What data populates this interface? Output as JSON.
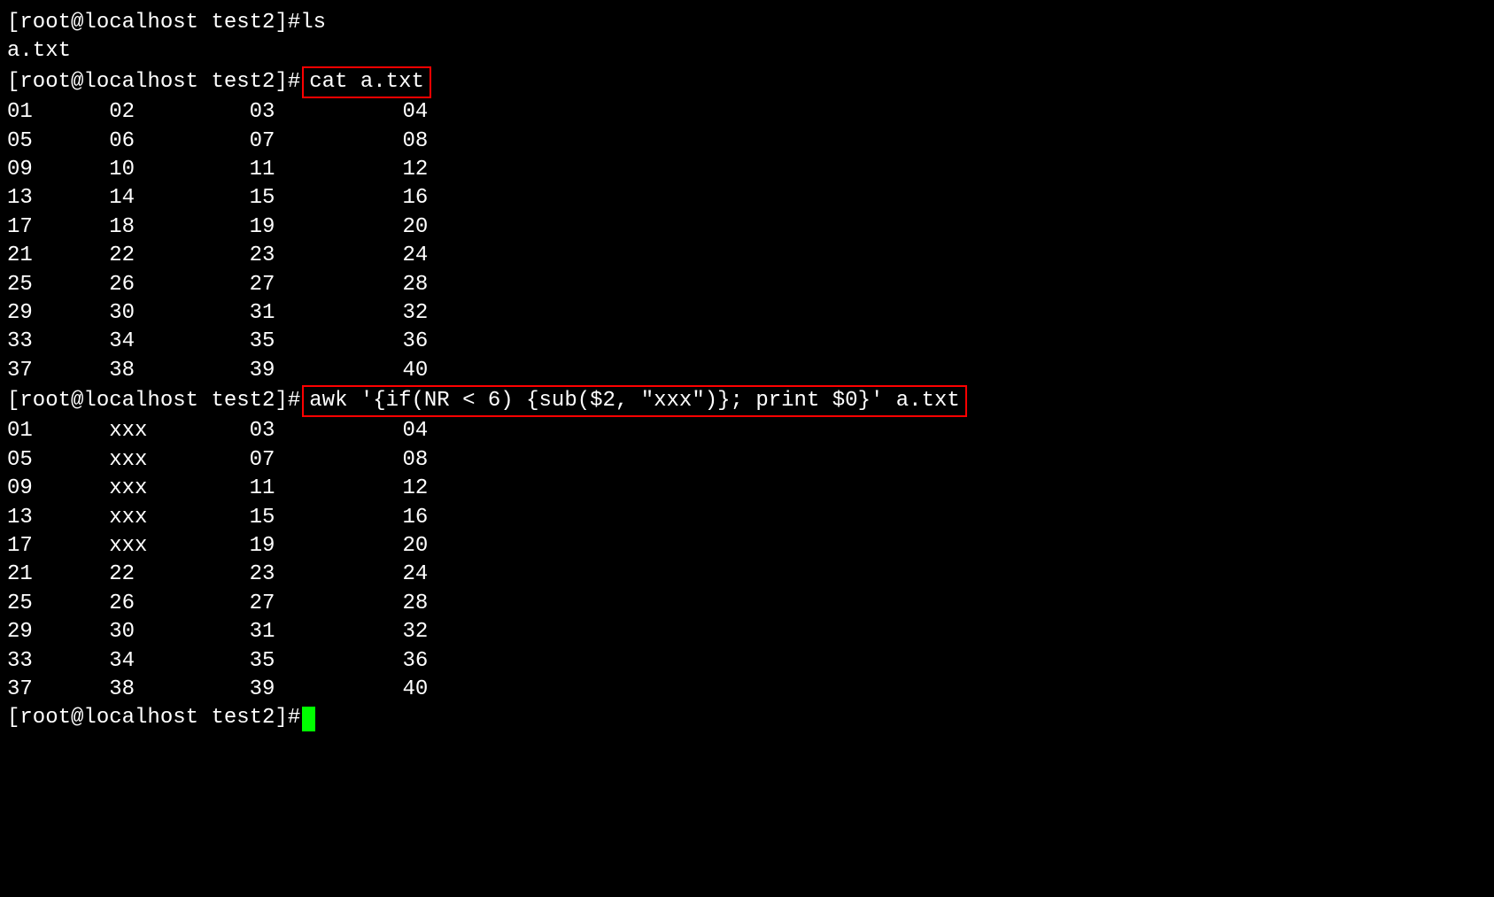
{
  "prompt": "[root@localhost test2]# ",
  "commands": {
    "ls": "ls",
    "cat": "cat a.txt",
    "awk": "awk '{if(NR < 6) {sub($2, \"xxx\")}; print $0}' a.txt"
  },
  "ls_output": "a.txt",
  "cat_output": [
    [
      "01",
      "02",
      "03",
      "04"
    ],
    [
      "05",
      "06",
      "07",
      "08"
    ],
    [
      "09",
      "10",
      "11",
      "12"
    ],
    [
      "13",
      "14",
      "15",
      "16"
    ],
    [
      "17",
      "18",
      "19",
      "20"
    ],
    [
      "21",
      "22",
      "23",
      "24"
    ],
    [
      "25",
      "26",
      "27",
      "28"
    ],
    [
      "29",
      "30",
      "31",
      "32"
    ],
    [
      "33",
      "34",
      "35",
      "36"
    ],
    [
      "37",
      "38",
      "39",
      "40"
    ]
  ],
  "awk_output": [
    [
      "01",
      "xxx",
      "03",
      "04"
    ],
    [
      "05",
      "xxx",
      "07",
      "08"
    ],
    [
      "09",
      "xxx",
      "11",
      "12"
    ],
    [
      "13",
      "xxx",
      "15",
      "16"
    ],
    [
      "17",
      "xxx",
      "19",
      "20"
    ],
    [
      "21",
      "22",
      "23",
      "24"
    ],
    [
      "25",
      "26",
      "27",
      "28"
    ],
    [
      "29",
      "30",
      "31",
      "32"
    ],
    [
      "33",
      "34",
      "35",
      "36"
    ],
    [
      "37",
      "38",
      "39",
      "40"
    ]
  ]
}
